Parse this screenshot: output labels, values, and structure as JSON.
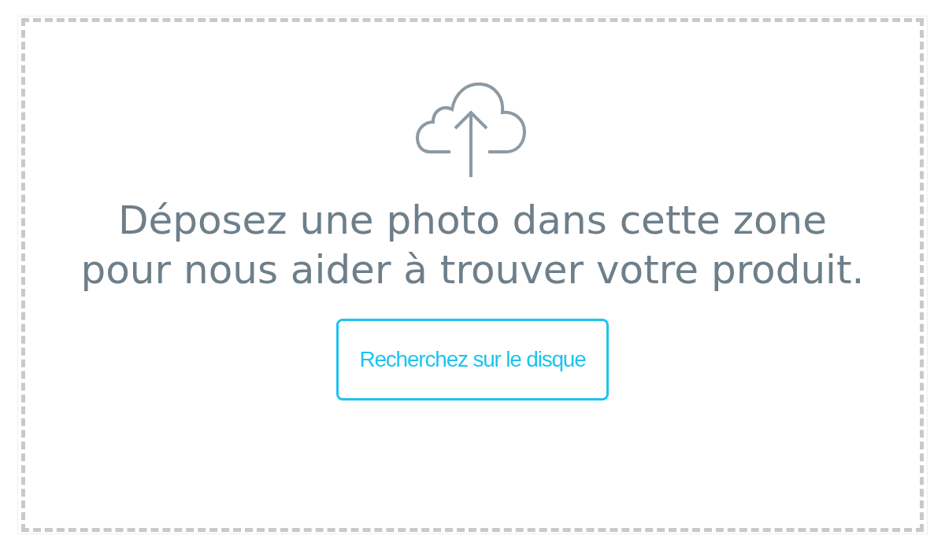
{
  "dropzone": {
    "message": "Déposez une photo dans cette zone pour nous aider à trouver votre produit.",
    "button": "Recherchez sur le disque"
  }
}
